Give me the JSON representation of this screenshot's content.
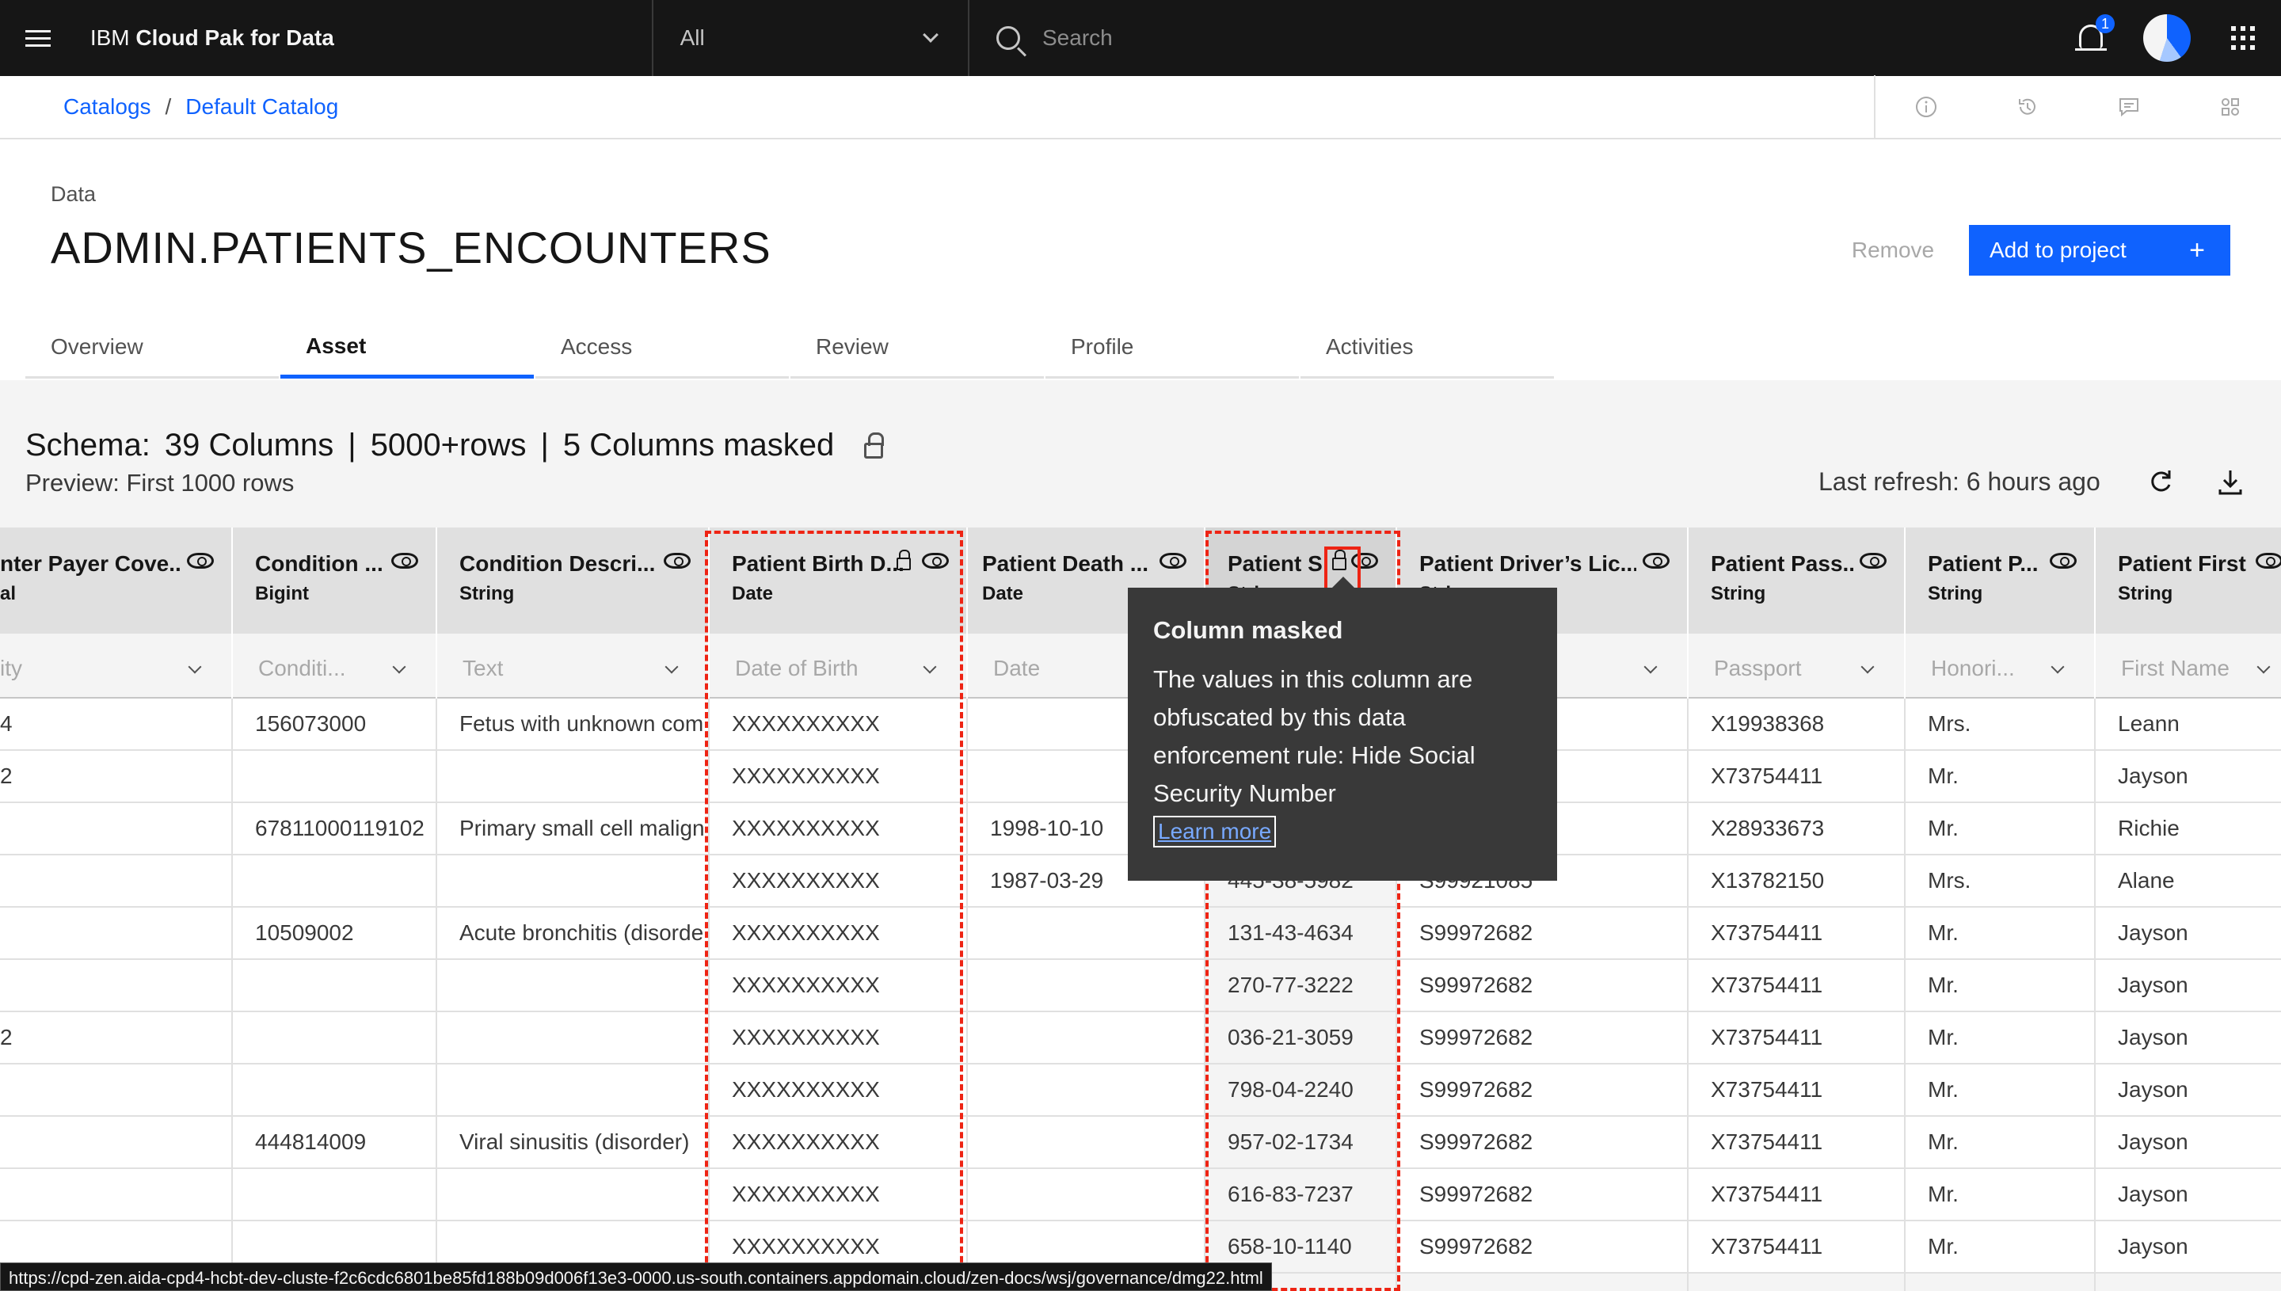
{
  "topbar": {
    "brand_prefix": "IBM ",
    "brand_name": "Cloud Pak for Data",
    "scope": "All",
    "search_placeholder": "Search",
    "notification_count": "1"
  },
  "breadcrumb": {
    "items": [
      "Catalogs",
      "Default Catalog"
    ],
    "separator": "/"
  },
  "header": {
    "label": "Data",
    "title": "ADMIN.PATIENTS_ENCOUNTERS",
    "remove_label": "Remove",
    "add_label": "Add to project",
    "add_icon": "+"
  },
  "tabs": [
    "Overview",
    "Asset",
    "Access",
    "Review",
    "Profile",
    "Activities"
  ],
  "active_tab": "Asset",
  "schema": {
    "prefix": "Schema:",
    "columns": "39 Columns",
    "rows": "5000+rows",
    "masked": "5 Columns masked",
    "sep": "|",
    "preview": "Preview: First 1000 rows",
    "last_refresh": "Last refresh: 6 hours ago"
  },
  "table": {
    "columns": [
      {
        "name": "nter Payer Cove...",
        "type": "al",
        "filter": "ity"
      },
      {
        "name": "Condition ...",
        "type": "Bigint",
        "filter": "Conditi..."
      },
      {
        "name": "Condition Descri...",
        "type": "String",
        "filter": "Text"
      },
      {
        "name": "Patient Birth D...",
        "type": "Date",
        "filter": "Date of Birth"
      },
      {
        "name": "Patient Death ...",
        "type": "Date",
        "filter": "Date"
      },
      {
        "name": "Patient S",
        "type": "String",
        "filter": ""
      },
      {
        "name": "Patient Driver’s Lic...",
        "type": "String",
        "filter": "se"
      },
      {
        "name": "Patient Pass...",
        "type": "String",
        "filter": "Passport"
      },
      {
        "name": "Patient P...",
        "type": "String",
        "filter": "Honori..."
      },
      {
        "name": "Patient First N...",
        "type": "String",
        "filter": "First Name"
      }
    ],
    "rows": [
      [
        "4",
        "156073000",
        "Fetus with unknown com",
        "XXXXXXXXXX",
        "",
        "",
        "",
        "X19938368",
        "Mrs.",
        "Leann"
      ],
      [
        "2",
        "",
        "",
        "XXXXXXXXXX",
        "",
        "",
        "",
        "X73754411",
        "Mr.",
        "Jayson"
      ],
      [
        "",
        "67811000119102",
        "Primary small cell malign",
        "XXXXXXXXXX",
        "1998-10-10",
        "",
        "",
        "X28933673",
        "Mr.",
        "Richie"
      ],
      [
        "",
        "",
        "",
        "XXXXXXXXXX",
        "1987-03-29",
        "445-38-5982",
        "S99921085",
        "X13782150",
        "Mrs.",
        "Alane"
      ],
      [
        "",
        "10509002",
        "Acute bronchitis (disorde",
        "XXXXXXXXXX",
        "",
        "131-43-4634",
        "S99972682",
        "X73754411",
        "Mr.",
        "Jayson"
      ],
      [
        "",
        "",
        "",
        "XXXXXXXXXX",
        "",
        "270-77-3222",
        "S99972682",
        "X73754411",
        "Mr.",
        "Jayson"
      ],
      [
        "2",
        "",
        "",
        "XXXXXXXXXX",
        "",
        "036-21-3059",
        "S99972682",
        "X73754411",
        "Mr.",
        "Jayson"
      ],
      [
        "",
        "",
        "",
        "XXXXXXXXXX",
        "",
        "798-04-2240",
        "S99972682",
        "X73754411",
        "Mr.",
        "Jayson"
      ],
      [
        "",
        "444814009",
        "Viral sinusitis (disorder)",
        "XXXXXXXXXX",
        "",
        "957-02-1734",
        "S99972682",
        "X73754411",
        "Mr.",
        "Jayson"
      ],
      [
        "",
        "",
        "",
        "XXXXXXXXXX",
        "",
        "616-83-7237",
        "S99972682",
        "X73754411",
        "Mr.",
        "Jayson"
      ],
      [
        "",
        "",
        "",
        "XXXXXXXXXX",
        "",
        "658-10-1140",
        "S99972682",
        "X73754411",
        "Mr.",
        "Jayson"
      ]
    ]
  },
  "tooltip": {
    "title": "Column masked",
    "body": "The values in this column are obfuscated by this data enforcement rule: Hide Social Security Number",
    "link": "Learn more"
  },
  "status_bar": "https://cpd-zen.aida-cpd4-hcbt-dev-cluste-f2c6cdc6801be85fd188b09d006f13e3-0000.us-south.containers.appdomain.cloud/zen-docs/wsj/governance/dmg22.html",
  "colors": {
    "primary": "#0f62fe",
    "highlight": "#ee2414",
    "topbar": "#161616"
  }
}
